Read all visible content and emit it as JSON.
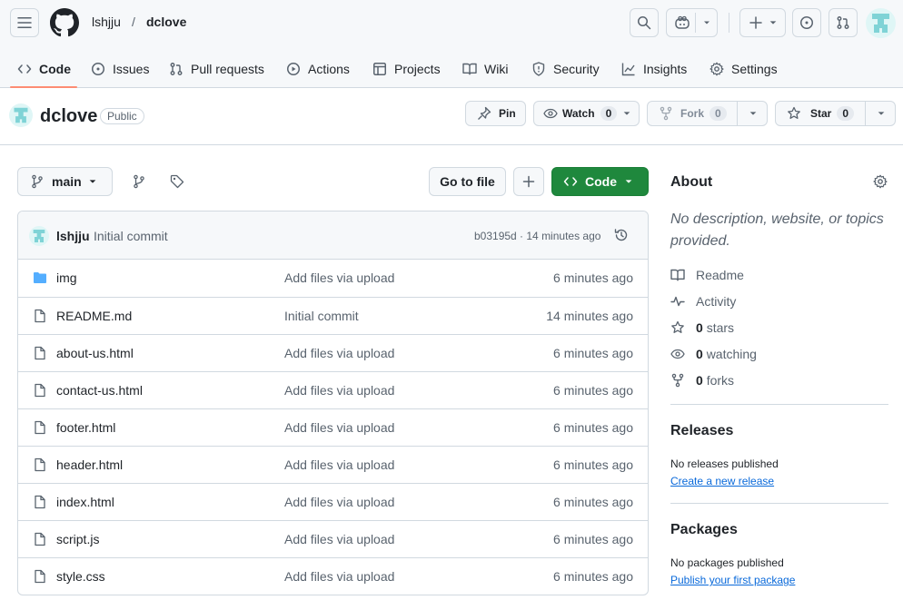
{
  "header": {
    "owner": "lshjju",
    "separator": "/",
    "repo": "dclove"
  },
  "tabs": [
    {
      "label": "Code",
      "icon": "code-icon"
    },
    {
      "label": "Issues",
      "icon": "issue-icon"
    },
    {
      "label": "Pull requests",
      "icon": "pull-request-icon"
    },
    {
      "label": "Actions",
      "icon": "play-icon"
    },
    {
      "label": "Projects",
      "icon": "table-icon"
    },
    {
      "label": "Wiki",
      "icon": "book-icon"
    },
    {
      "label": "Security",
      "icon": "shield-icon"
    },
    {
      "label": "Insights",
      "icon": "graph-icon"
    },
    {
      "label": "Settings",
      "icon": "gear-icon"
    }
  ],
  "repo": {
    "name": "dclove",
    "visibility": "Public",
    "pin": "Pin",
    "watch": "Watch",
    "watch_count": "0",
    "fork": "Fork",
    "fork_count": "0",
    "star": "Star",
    "star_count": "0"
  },
  "toolbar": {
    "branch": "main",
    "goto": "Go to file",
    "code": "Code"
  },
  "commit": {
    "author": "lshjju",
    "message": "Initial commit",
    "hash_time": "b03195d · 14 minutes ago"
  },
  "files": [
    {
      "name": "img",
      "type": "folder",
      "msg": "Add files via upload",
      "age": "6 minutes ago"
    },
    {
      "name": "README.md",
      "type": "file",
      "msg": "Initial commit",
      "age": "14 minutes ago"
    },
    {
      "name": "about-us.html",
      "type": "file",
      "msg": "Add files via upload",
      "age": "6 minutes ago"
    },
    {
      "name": "contact-us.html",
      "type": "file",
      "msg": "Add files via upload",
      "age": "6 minutes ago"
    },
    {
      "name": "footer.html",
      "type": "file",
      "msg": "Add files via upload",
      "age": "6 minutes ago"
    },
    {
      "name": "header.html",
      "type": "file",
      "msg": "Add files via upload",
      "age": "6 minutes ago"
    },
    {
      "name": "index.html",
      "type": "file",
      "msg": "Add files via upload",
      "age": "6 minutes ago"
    },
    {
      "name": "script.js",
      "type": "file",
      "msg": "Add files via upload",
      "age": "6 minutes ago"
    },
    {
      "name": "style.css",
      "type": "file",
      "msg": "Add files via upload",
      "age": "6 minutes ago"
    }
  ],
  "about": {
    "title": "About",
    "desc": "No description, website, or topics provided.",
    "readme": "Readme",
    "activity": "Activity",
    "stars_n": "0",
    "stars": "stars",
    "watching_n": "0",
    "watching": "watching",
    "forks_n": "0",
    "forks": "forks"
  },
  "releases": {
    "title": "Releases",
    "none": "No releases published",
    "link": "Create a new release"
  },
  "packages": {
    "title": "Packages",
    "none": "No packages published",
    "link": "Publish your first package"
  },
  "colors": {
    "accent": "#fd8c73",
    "green": "#1f883d",
    "link": "#0969da",
    "folder": "#54aeff"
  }
}
